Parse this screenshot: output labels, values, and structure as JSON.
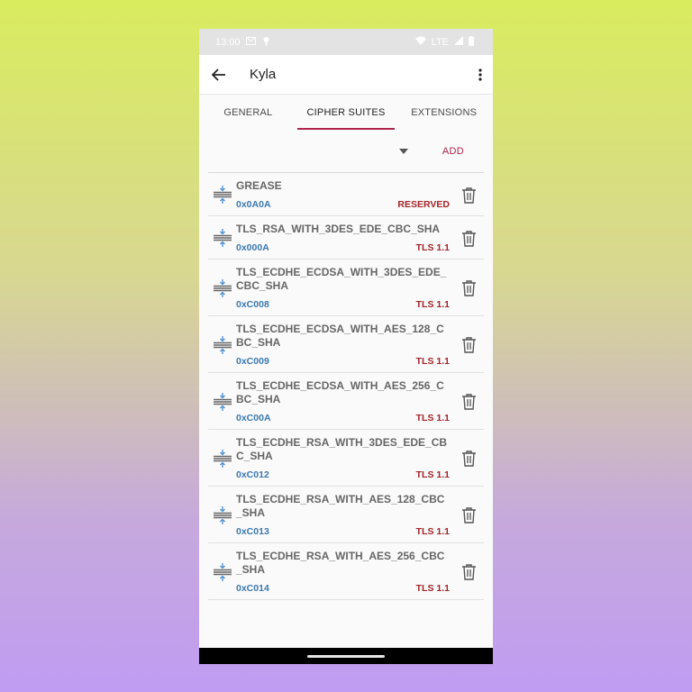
{
  "status_bar": {
    "time": "13:00",
    "network": "LTE"
  },
  "app_bar": {
    "title": "Kyla"
  },
  "tabs": [
    {
      "label": "GENERAL",
      "active": false
    },
    {
      "label": "CIPHER SUITES",
      "active": true
    },
    {
      "label": "EXTENSIONS",
      "active": false
    }
  ],
  "add_row": {
    "selected_value": "",
    "add_label": "ADD"
  },
  "cipher_suites": [
    {
      "name": "GREASE",
      "code": "0x0A0A",
      "version": "RESERVED"
    },
    {
      "name": "TLS_RSA_WITH_3DES_EDE_CBC_SHA",
      "code": "0x000A",
      "version": "TLS 1.1"
    },
    {
      "name": "TLS_ECDHE_ECDSA_WITH_3DES_EDE_CBC_SHA",
      "code": "0xC008",
      "version": "TLS 1.1"
    },
    {
      "name": "TLS_ECDHE_ECDSA_WITH_AES_128_CBC_SHA",
      "code": "0xC009",
      "version": "TLS 1.1"
    },
    {
      "name": "TLS_ECDHE_ECDSA_WITH_AES_256_CBC_SHA",
      "code": "0xC00A",
      "version": "TLS 1.1"
    },
    {
      "name": "TLS_ECDHE_RSA_WITH_3DES_EDE_CBC_SHA",
      "code": "0xC012",
      "version": "TLS 1.1"
    },
    {
      "name": "TLS_ECDHE_RSA_WITH_AES_128_CBC_SHA",
      "code": "0xC013",
      "version": "TLS 1.1"
    },
    {
      "name": "TLS_ECDHE_RSA_WITH_AES_256_CBC_SHA",
      "code": "0xC014",
      "version": "TLS 1.1"
    }
  ],
  "colors": {
    "accent": "#b0234a",
    "code": "#3a78b0",
    "version": "#a3242a"
  }
}
